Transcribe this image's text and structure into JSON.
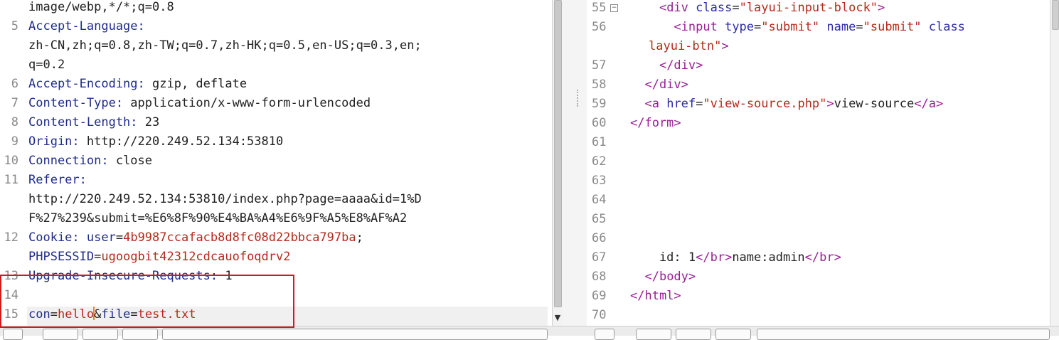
{
  "request": {
    "lines": [
      {
        "num": "",
        "parts": [
          {
            "c": "txt",
            "t": "image/webp,*/*;q=0.8"
          }
        ]
      },
      {
        "num": "5",
        "parts": [
          {
            "c": "hk",
            "t": "Accept-Language:"
          }
        ]
      },
      {
        "num": "",
        "parts": [
          {
            "c": "txt",
            "t": "zh-CN,zh;q=0.8,zh-TW;q=0.7,zh-HK;q=0.5,en-US;q=0.3,en;"
          }
        ]
      },
      {
        "num": "",
        "parts": [
          {
            "c": "txt",
            "t": "q=0.2"
          }
        ]
      },
      {
        "num": "6",
        "parts": [
          {
            "c": "hk",
            "t": "Accept-Encoding: "
          },
          {
            "c": "txt",
            "t": "gzip, deflate"
          }
        ]
      },
      {
        "num": "7",
        "parts": [
          {
            "c": "hk",
            "t": "Content-Type: "
          },
          {
            "c": "txt",
            "t": "application/x-www-form-urlencoded"
          }
        ]
      },
      {
        "num": "8",
        "parts": [
          {
            "c": "hk",
            "t": "Content-Length: "
          },
          {
            "c": "txt",
            "t": "23"
          }
        ]
      },
      {
        "num": "9",
        "parts": [
          {
            "c": "hk",
            "t": "Origin: "
          },
          {
            "c": "txt",
            "t": "http://220.249.52.134:53810"
          }
        ]
      },
      {
        "num": "10",
        "parts": [
          {
            "c": "hk",
            "t": "Connection: "
          },
          {
            "c": "txt",
            "t": "close"
          }
        ]
      },
      {
        "num": "11",
        "parts": [
          {
            "c": "hk",
            "t": "Referer:"
          }
        ]
      },
      {
        "num": "",
        "parts": [
          {
            "c": "txt",
            "t": "http://220.249.52.134:53810/index.php?page=aaaa&id=1%D"
          }
        ]
      },
      {
        "num": "",
        "parts": [
          {
            "c": "txt",
            "t": "F%27%239&submit=%E6%8F%90%E4%BA%A4%E6%9F%A5%E8%AF%A2"
          }
        ]
      },
      {
        "num": "12",
        "parts": [
          {
            "c": "hk",
            "t": "Cookie: "
          },
          {
            "c": "hk",
            "t": "user"
          },
          {
            "c": "txt",
            "t": "="
          },
          {
            "c": "val",
            "t": "4b9987ccafacb8d8fc08d22bbca797ba"
          },
          {
            "c": "txt",
            "t": ";"
          }
        ]
      },
      {
        "num": "",
        "parts": [
          {
            "c": "hk",
            "t": "PHPSESSID"
          },
          {
            "c": "txt",
            "t": "="
          },
          {
            "c": "val",
            "t": "ugoogbit42312cdcauofoqdrv2"
          }
        ]
      },
      {
        "num": "13",
        "parts": [
          {
            "c": "hk",
            "t": "Upgrade-Insecure-Requests: "
          },
          {
            "c": "txt",
            "t": "1"
          }
        ]
      },
      {
        "num": "14",
        "parts": []
      },
      {
        "num": "15",
        "parts": [
          {
            "c": "hk",
            "t": "con"
          },
          {
            "c": "txt",
            "t": "="
          },
          {
            "c": "val",
            "t": "hello"
          },
          {
            "c": "caret",
            "t": ""
          },
          {
            "c": "txt",
            "t": "&"
          },
          {
            "c": "hk",
            "t": "file"
          },
          {
            "c": "txt",
            "t": "="
          },
          {
            "c": "val",
            "t": "test.txt"
          }
        ]
      }
    ]
  },
  "response": {
    "lines": [
      {
        "num": "55",
        "fold": true,
        "parts": [
          {
            "c": "txt",
            "t": "    "
          },
          {
            "c": "tag",
            "t": "<div "
          },
          {
            "c": "attr",
            "t": "class"
          },
          {
            "c": "txt",
            "t": "="
          },
          {
            "c": "str",
            "t": "\"layui-input-block\""
          },
          {
            "c": "tag",
            "t": ">"
          }
        ]
      },
      {
        "num": "56",
        "parts": [
          {
            "c": "txt",
            "t": "      "
          },
          {
            "c": "tag",
            "t": "<input "
          },
          {
            "c": "attr",
            "t": "type"
          },
          {
            "c": "txt",
            "t": "="
          },
          {
            "c": "str",
            "t": "\"submit\" "
          },
          {
            "c": "attr",
            "t": "name"
          },
          {
            "c": "txt",
            "t": "="
          },
          {
            "c": "str",
            "t": "\"submit\" "
          },
          {
            "c": "attr",
            "t": "class"
          }
        ]
      },
      {
        "num": "",
        "wrap": true,
        "parts": [
          {
            "c": "str",
            "t": "layui-btn\""
          },
          {
            "c": "tag",
            "t": ">"
          }
        ]
      },
      {
        "num": "57",
        "parts": [
          {
            "c": "txt",
            "t": "    "
          },
          {
            "c": "tag",
            "t": "</div>"
          }
        ]
      },
      {
        "num": "58",
        "parts": [
          {
            "c": "txt",
            "t": "  "
          },
          {
            "c": "tag",
            "t": "</div>"
          }
        ]
      },
      {
        "num": "59",
        "parts": [
          {
            "c": "txt",
            "t": "  "
          },
          {
            "c": "tag",
            "t": "<a "
          },
          {
            "c": "attr",
            "t": "href"
          },
          {
            "c": "txt",
            "t": "="
          },
          {
            "c": "str",
            "t": "\"view-source.php\""
          },
          {
            "c": "tag",
            "t": ">"
          },
          {
            "c": "txt",
            "t": "view-source"
          },
          {
            "c": "tag",
            "t": "</a>"
          }
        ]
      },
      {
        "num": "60",
        "parts": [
          {
            "c": "tag",
            "t": "</form>"
          }
        ]
      },
      {
        "num": "61",
        "parts": []
      },
      {
        "num": "62",
        "parts": []
      },
      {
        "num": "63",
        "parts": []
      },
      {
        "num": "64",
        "parts": []
      },
      {
        "num": "65",
        "parts": []
      },
      {
        "num": "66",
        "parts": []
      },
      {
        "num": "67",
        "parts": [
          {
            "c": "txt",
            "t": "    id: 1"
          },
          {
            "c": "tag",
            "t": "</br>"
          },
          {
            "c": "txt",
            "t": "name:admin"
          },
          {
            "c": "tag",
            "t": "</br>"
          }
        ]
      },
      {
        "num": "68",
        "parts": [
          {
            "c": "txt",
            "t": "  "
          },
          {
            "c": "tag",
            "t": "</body>"
          }
        ]
      },
      {
        "num": "69",
        "parts": [
          {
            "c": "tag",
            "t": "</html>"
          }
        ]
      },
      {
        "num": "70",
        "parts": []
      }
    ]
  },
  "colors": {
    "header_key": "#1f2d8a",
    "value": "#b52a1c",
    "tag": "#9a1f95",
    "highlight_box": "#d11a1a",
    "caret": "#e8892a"
  },
  "icons": {
    "scroll_down": "▼",
    "fold": "⊟"
  }
}
